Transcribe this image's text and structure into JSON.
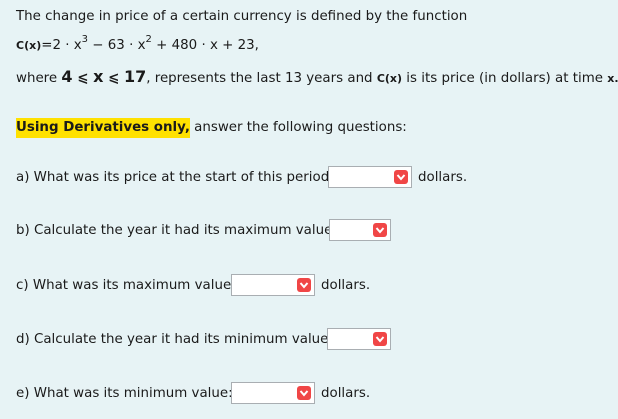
{
  "intro": {
    "line1": "The change in price of a certain currency is defined by the function",
    "eq_prefix": "C(x)",
    "eq_t1": "=2 · x",
    "eq_t1_exp": "3",
    "eq_t2": " − 63 · x",
    "eq_t2_exp": "2",
    "eq_t3": " + 480 · x + 23,",
    "where_word": "where ",
    "range_lo": "4",
    "range_ineq1": " ⩽ ",
    "range_var": "x",
    "range_ineq2": " ⩽ ",
    "range_hi": "17",
    "where_mid": ", represents the last 13 years and ",
    "price_fn": "C(x)",
    "where_end": " is its price (in dollars) at time ",
    "time_var": "x."
  },
  "instruction": {
    "highlight": "Using Derivatives only,",
    "rest": " answer the following questions:"
  },
  "questions": {
    "a": {
      "label": "a) What was its price at the start of this period:",
      "unit": "dollars.",
      "value": ""
    },
    "b": {
      "label": "b) Calculate the year it had its maximum value:",
      "unit": "",
      "value": ""
    },
    "c": {
      "label": "c) What was its maximum value:",
      "unit": "dollars.",
      "value": ""
    },
    "d": {
      "label": "d) Calculate the year it had its minimum value:",
      "unit": "",
      "value": ""
    },
    "e": {
      "label": "e) What was its minimum value:",
      "unit": "dollars.",
      "value": ""
    }
  },
  "colors": {
    "background": "#e7f3f5",
    "highlight": "#ffe100",
    "dropdown_badge": "#f04646"
  },
  "icons": {
    "dropdown": "chevron-down-icon"
  }
}
